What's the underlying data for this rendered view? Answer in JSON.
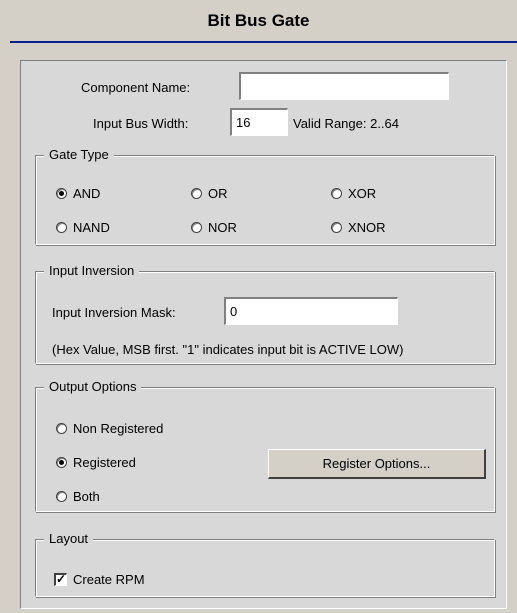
{
  "title": "Bit Bus Gate",
  "component_name": {
    "label": "Component Name:",
    "value": ""
  },
  "input_bus_width": {
    "label": "Input Bus Width:",
    "value": "16",
    "valid_range": "Valid Range: 2..64"
  },
  "gate_type": {
    "title": "Gate Type",
    "options": [
      "AND",
      "OR",
      "XOR",
      "NAND",
      "NOR",
      "XNOR"
    ],
    "selected": "AND"
  },
  "input_inversion": {
    "title": "Input Inversion",
    "mask_label": "Input Inversion Mask:",
    "mask_value": "0",
    "note": "(Hex Value, MSB first. \"1\" indicates input bit is ACTIVE LOW)"
  },
  "output_options": {
    "title": "Output Options",
    "options": [
      "Non Registered",
      "Registered",
      "Both"
    ],
    "selected": "Registered",
    "register_button": "Register Options..."
  },
  "layout": {
    "title": "Layout",
    "create_rpm_label": "Create RPM",
    "create_rpm_checked": true
  }
}
